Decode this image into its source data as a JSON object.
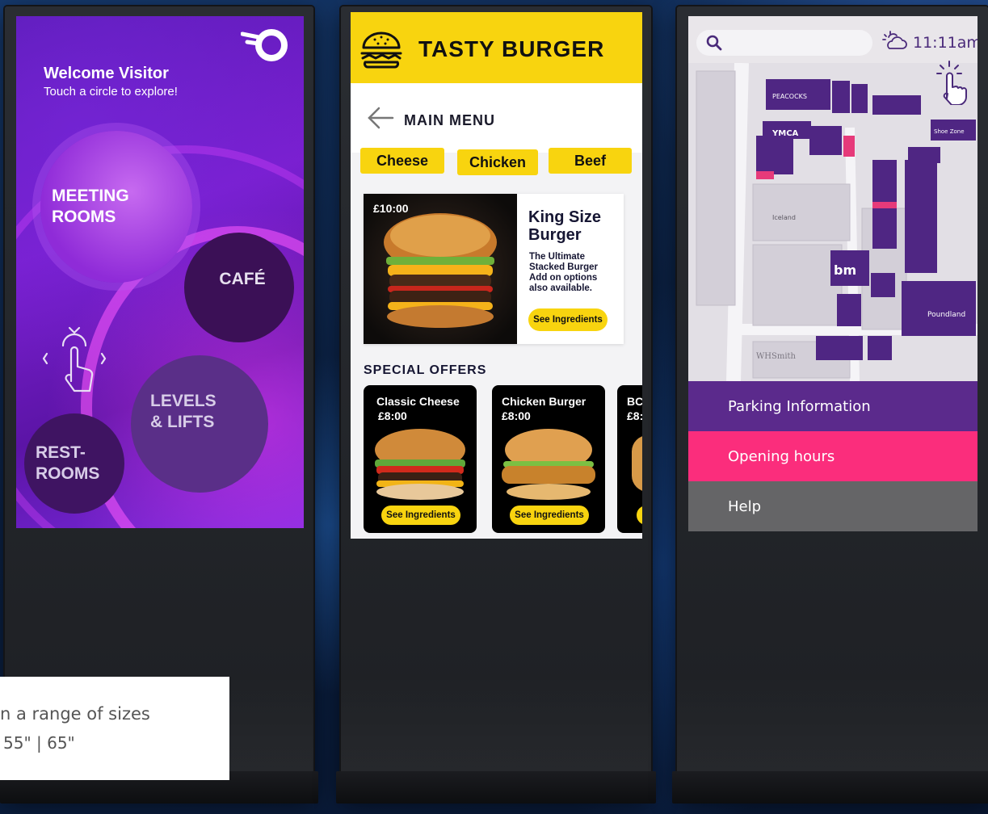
{
  "kiosk1": {
    "welcome_title": "Welcome Visitor",
    "welcome_subtitle": "Touch a circle to explore!",
    "circles": {
      "meeting_rooms": "MEETING\nROOMS",
      "cafe": "CAFÉ",
      "levels_lifts": "LEVELS\n& LIFTS",
      "restrooms": "REST-\nROOMS"
    },
    "accent_color": "#7a1fd0"
  },
  "caption": {
    "line1": "n a range of sizes",
    "line2": "55\" | 65\""
  },
  "kiosk2": {
    "brand": "TASTY BURGER",
    "main_menu": "MAIN MENU",
    "categories": [
      "Cheese",
      "Chicken",
      "Beef"
    ],
    "featured": {
      "price": "£10:00",
      "title": "King Size\nBurger",
      "description": "The Ultimate\nStacked Burger\nAdd on options\nalso available.",
      "button": "See Ingredients"
    },
    "special_offers_title": "SPECIAL OFFERS",
    "offers": [
      {
        "name": "Classic Cheese",
        "price": "£8:00",
        "button": "See Ingredients"
      },
      {
        "name": "Chicken Burger",
        "price": "£8:00",
        "button": "See Ingredients"
      },
      {
        "name": "BC",
        "price": "£8:",
        "button": ""
      }
    ],
    "brand_color": "#f8d40f"
  },
  "kiosk3": {
    "search_placeholder": "",
    "time": "11:11am",
    "map_labels": {
      "iceland": "Iceland",
      "whsmith": "WHSmith",
      "poundland": "Poundland",
      "shoe_zone": "Shoe Zone",
      "ymca": "YMCA"
    },
    "menu": [
      {
        "label": "Parking Information",
        "color": "#5b2a8c"
      },
      {
        "label": "Opening hours",
        "color": "#fb2d7c"
      },
      {
        "label": "Help",
        "color": "#656567"
      }
    ]
  }
}
